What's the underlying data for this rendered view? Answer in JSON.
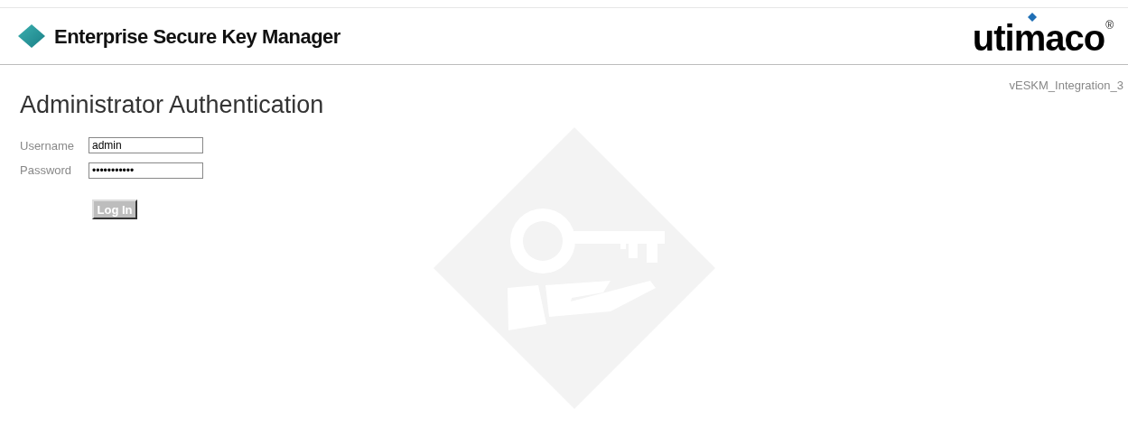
{
  "header": {
    "title": "Enterprise Secure Key Manager",
    "logo": {
      "text": "utimaco",
      "mark": "®"
    }
  },
  "page": {
    "title": "Administrator Authentication",
    "instance": "vESKM_Integration_3"
  },
  "form": {
    "fields": [
      {
        "label": "Username",
        "value": "admin"
      },
      {
        "label": "Password",
        "value": "•••••••••••"
      }
    ],
    "button": {
      "label": "Log In",
      "disabled": true
    }
  }
}
